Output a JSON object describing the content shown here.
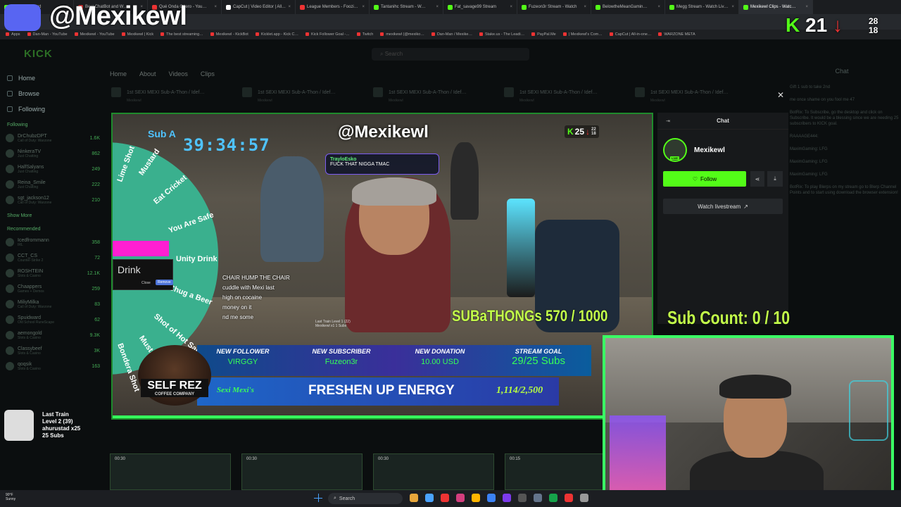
{
  "browser": {
    "tabs": [
      {
        "label": "Kick Dashboard",
        "color": "#53fc18"
      },
      {
        "label": "Best ChatBot and W…",
        "color": "#e33"
      },
      {
        "label": "Qué Onda Güero - You…",
        "color": "#e33"
      },
      {
        "label": "CapCut | Video Editor | All…",
        "color": "#fff"
      },
      {
        "label": "League Members - Foozi…",
        "color": "#e33"
      },
      {
        "label": "Tantanihc Stream - W…",
        "color": "#53fc18"
      },
      {
        "label": "Fat_savage99 Stream",
        "color": "#53fc18"
      },
      {
        "label": "Fuzeon3r Stream - Watch",
        "color": "#53fc18"
      },
      {
        "label": "BelowtheMeanGamin…",
        "color": "#53fc18"
      },
      {
        "label": "Megg Stream - Watch Liv…",
        "color": "#53fc18"
      },
      {
        "label": "Mexikewl Clips - Watc…",
        "color": "#53fc18"
      }
    ],
    "bookmarks": [
      "Apps",
      "Dan-Man - YouTube",
      "Mexikewl - YouTube",
      "Mexikewl | Kick",
      "The best streaming…",
      "Mexikewl - KickBot",
      "Kicklet.app - Kick C…",
      "Kick Follower Goal -…",
      "Twitch",
      "mexikewl (@mexiko…",
      "Dan-Man / Mexike…",
      "Stake.us - The Leadi…",
      "PayPal.Me",
      "| Mexikewl's Com…",
      "CapCut | All-in-one…",
      "WARZONE META"
    ]
  },
  "overlay_top": {
    "channel_handle": "@Mexikewl",
    "k_count": "21",
    "mini_top": "28",
    "mini_bottom": "18"
  },
  "kick": {
    "logo": "KICK",
    "search_placeholder": "Search",
    "nav": [
      {
        "label": "Home",
        "icon": "home-icon"
      },
      {
        "label": "Browse",
        "icon": "browse-icon"
      },
      {
        "label": "Following",
        "icon": "heart-icon"
      }
    ],
    "following_title": "Following",
    "following": [
      {
        "name": "DrChubzDPT",
        "cat": "Call of Duty: Warzone",
        "count": "1.6K"
      },
      {
        "name": "NinkeraTV",
        "cat": "Just Chatting",
        "count": "862"
      },
      {
        "name": "HalfSalyans",
        "cat": "Just Chatting",
        "count": "249"
      },
      {
        "name": "Reina_Smile",
        "cat": "Just Chatting",
        "count": "222"
      },
      {
        "name": "sgt_jackson12",
        "cat": "Call of Duty: Warzone",
        "count": "210"
      }
    ],
    "show_more": "Show More",
    "recommended_title": "Recommended",
    "recommended": [
      {
        "name": "Icedfrommann",
        "cat": "IRL",
        "count": "358"
      },
      {
        "name": "CCT_CS",
        "cat": "Counter-Strike 2",
        "count": "72"
      },
      {
        "name": "ROSHTEIN",
        "cat": "Slots & Casino",
        "count": "12.1K"
      },
      {
        "name": "Chaappers",
        "cat": "Games + Demos",
        "count": "259"
      },
      {
        "name": "MiliyMilka",
        "cat": "Call of Duty: Warzone",
        "count": "83"
      },
      {
        "name": "Spuidward",
        "cat": "Old School RuneScape",
        "count": "62"
      },
      {
        "name": "aemongold",
        "cat": "Slots & Casino",
        "count": "9.3K"
      },
      {
        "name": "Classybeef",
        "cat": "Slots & Casino",
        "count": "3K"
      },
      {
        "name": "qoqsik",
        "cat": "Slots & Casino",
        "count": "163"
      }
    ],
    "channel_tabs": [
      "Home",
      "About",
      "Videos",
      "Clips"
    ],
    "video_cards": [
      {
        "title": "1st SEXI MEXI Sub-A-Thon / Idef…",
        "sub": "Mexikewl"
      },
      {
        "title": "1st SEXI MEXI Sub-A-Thon / Idef…",
        "sub": "Mexikewl"
      },
      {
        "title": "1st SEXI MEXI Sub-A-Thon / Idef…",
        "sub": "Mexikewl"
      },
      {
        "title": "1st SEXI MEXI Sub-A-Thon / Idef…",
        "sub": "Mexikewl"
      },
      {
        "title": "1st SEXI MEXI Sub-A-Thon / Idef…",
        "sub": "Mexikewl"
      }
    ],
    "bottom_thumbs": [
      {
        "duration": "00:30"
      },
      {
        "duration": "00:30"
      },
      {
        "duration": "00:30"
      },
      {
        "duration": "00:15"
      }
    ],
    "bg_chat": {
      "title": "Chat",
      "messages": [
        "Gift 1 sub to take 2nd",
        "me once shame on you fool me 47",
        "BotRix: To Subscribe, go the desktop and click on Subscribe. It would be a blessing since we are needing 25 subscribers to KICK goal.",
        "RAAAAGE444:",
        "MaximGaming: LFG",
        "MaximGaming: LFG",
        "MaximGaming: LFG",
        "BotRix: To play Blerps on my stream go to Blerp Channel Points and to start using download the browser extension!"
      ]
    }
  },
  "stream": {
    "sub_label": "Sub A",
    "timer": "39:34:57",
    "handle": "@Mexikewl",
    "badge_k": "25",
    "badge_mini_top": "22",
    "badge_mini_bottom": "18",
    "alert_user": "TrayloEsko",
    "alert_msg": "FUCK THAT NIGGA TMAC",
    "wheel_items": [
      "Lime Shot",
      "Mustard",
      "Eat Cricket",
      "You Are Safe",
      "Unity Drink",
      "Chug a Beer",
      "Shot of Hot Sauce",
      "Mustard",
      "Bondera Shot"
    ],
    "drink_label": "Drink",
    "drink_close": "Close",
    "drink_remove": "Remove",
    "chat_lines": [
      "CHAIR HUMP THE CHAIR",
      "cuddle with Mexi last",
      "high on cocaine",
      "money on it",
      "nd me some"
    ],
    "subathon": "SUBaTHONGs 570 / 1000",
    "train_small": "Last Train Level 1 (22) Mexikewl x1 1 Subs",
    "alerts": [
      {
        "head": "NEW FOLLOWER",
        "value": "VIRGGY"
      },
      {
        "head": "NEW SUBSCRIBER",
        "value": "Fuzeon3r"
      },
      {
        "head": "NEW DONATION",
        "value": "10.00 USD"
      },
      {
        "head": "STREAM GOAL",
        "value": "29/25 Subs"
      }
    ],
    "sponsor_top": "SELF REZ",
    "sponsor_bottom": "COFFEE COMPANY",
    "sexi": "Sexi Mexi's",
    "energy": "FRESHEN UP ENERGY",
    "energy_count": "1,114/2,500"
  },
  "chat_panel": {
    "title": "Chat",
    "channel": "Mexikewl",
    "live": "LIVE",
    "follow": "Follow",
    "watch": "Watch livestream"
  },
  "sub_count": "Sub Count:  0 / 10",
  "train_left": {
    "title": "Last Train",
    "level": "Level 2 (39)",
    "user": "ahurustad x25",
    "subs": "25 Subs"
  },
  "taskbar": {
    "weather_temp": "90°F",
    "weather_desc": "Sunny",
    "search": "Search"
  },
  "colors": {
    "kick_green": "#53fc18",
    "overlay_green": "#35ff5c",
    "timer_blue": "#4fc3ff"
  }
}
